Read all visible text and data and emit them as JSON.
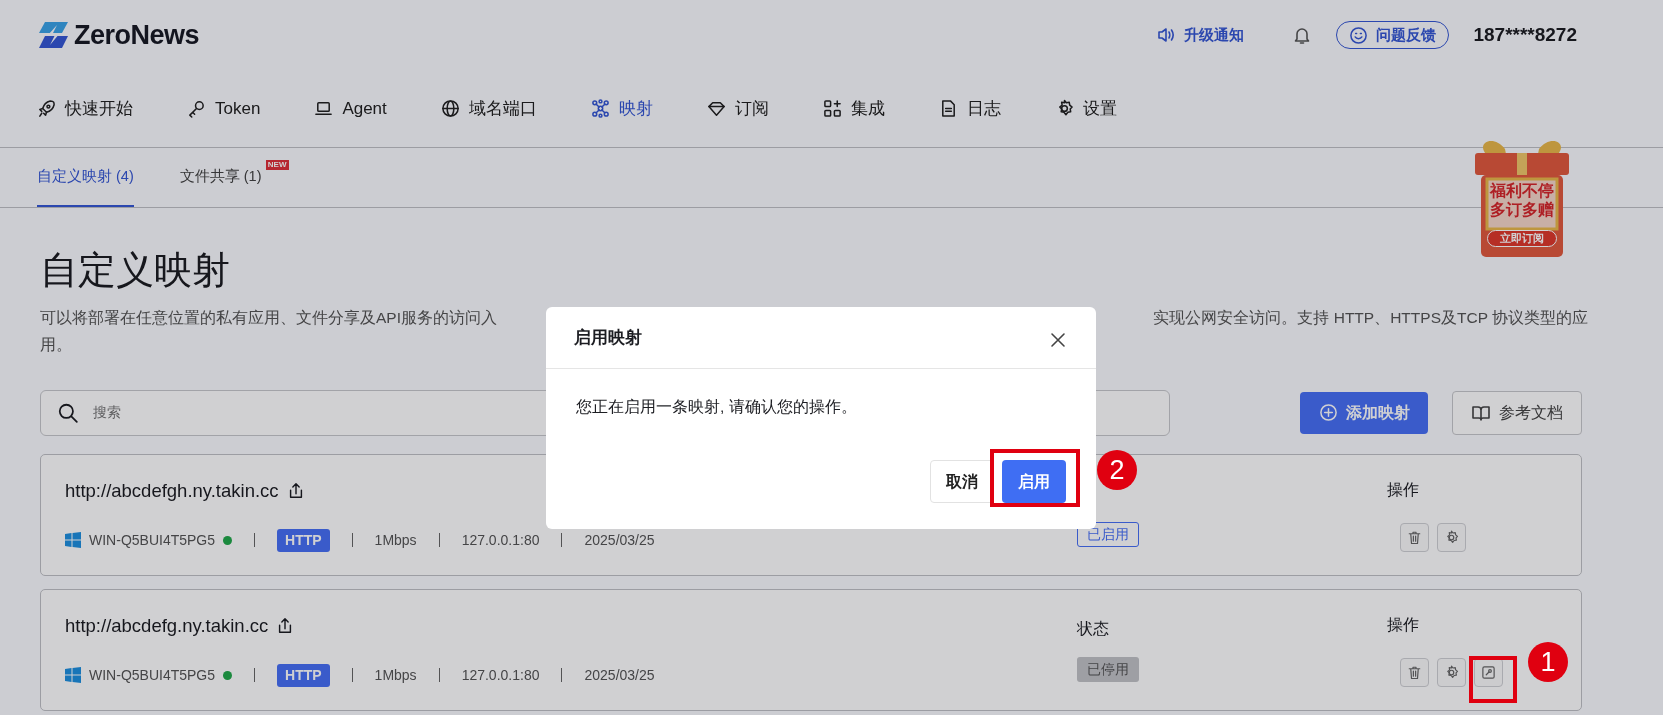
{
  "header": {
    "logo": "ZeroNews",
    "upgrade": "升级通知",
    "feedback": "问题反馈",
    "account": "187****8272"
  },
  "nav": [
    {
      "label": "快速开始",
      "selected": false
    },
    {
      "label": "Token",
      "selected": false
    },
    {
      "label": "Agent",
      "selected": false
    },
    {
      "label": "域名端口",
      "selected": false
    },
    {
      "label": "映射",
      "selected": true
    },
    {
      "label": "订阅",
      "selected": false
    },
    {
      "label": "集成",
      "selected": false
    },
    {
      "label": "日志",
      "selected": false
    },
    {
      "label": "设置",
      "selected": false
    }
  ],
  "subtabs": [
    {
      "label": "自定义映射 (4)",
      "selected": true
    },
    {
      "label": "文件共享 (1)",
      "selected": false,
      "badge": "NEW"
    }
  ],
  "promo": {
    "lines": [
      "福利不停",
      "多订多赠"
    ],
    "button": "立即订阅"
  },
  "page": {
    "title": "自定义映射",
    "description_left": "可以将部署在任意位置的私有应用、文件分享及API服务的访问入",
    "description_right": "实现公网安全访问。支持 HTTP、HTTPS及TCP 协议类型的应",
    "description_end": "用。"
  },
  "toolbar": {
    "search_placeholder": "搜索",
    "add": "添加映射",
    "docs": "参考文档"
  },
  "mappings": [
    {
      "url": "http://abcdefgh.ny.takin.cc",
      "host": "WIN-Q5BUI4T5PG5",
      "online": true,
      "protocol": "HTTP",
      "bandwidth": "1Mbps",
      "address": "127.0.0.1:80",
      "date": "2025/03/25",
      "actions_label": "操作",
      "status": "已启用",
      "enabled": true,
      "actions": [
        {
          "kind": "delete"
        },
        {
          "kind": "settings"
        }
      ]
    },
    {
      "url": "http://abcdefg.ny.takin.cc",
      "host": "WIN-Q5BUI4T5PG5",
      "online": true,
      "protocol": "HTTP",
      "bandwidth": "1Mbps",
      "address": "127.0.0.1:80",
      "date": "2025/03/25",
      "status_label": "状态",
      "actions_label": "操作",
      "status": "已停用",
      "enabled": false,
      "actions": [
        {
          "kind": "delete"
        },
        {
          "kind": "settings"
        },
        {
          "kind": "enable"
        }
      ]
    }
  ],
  "modal": {
    "title": "启用映射",
    "message": "您正在启用一条映射, 请确认您的操作。",
    "cancel": "取消",
    "confirm": "启用"
  },
  "annotations": [
    {
      "label": "2"
    },
    {
      "label": "1"
    }
  ]
}
